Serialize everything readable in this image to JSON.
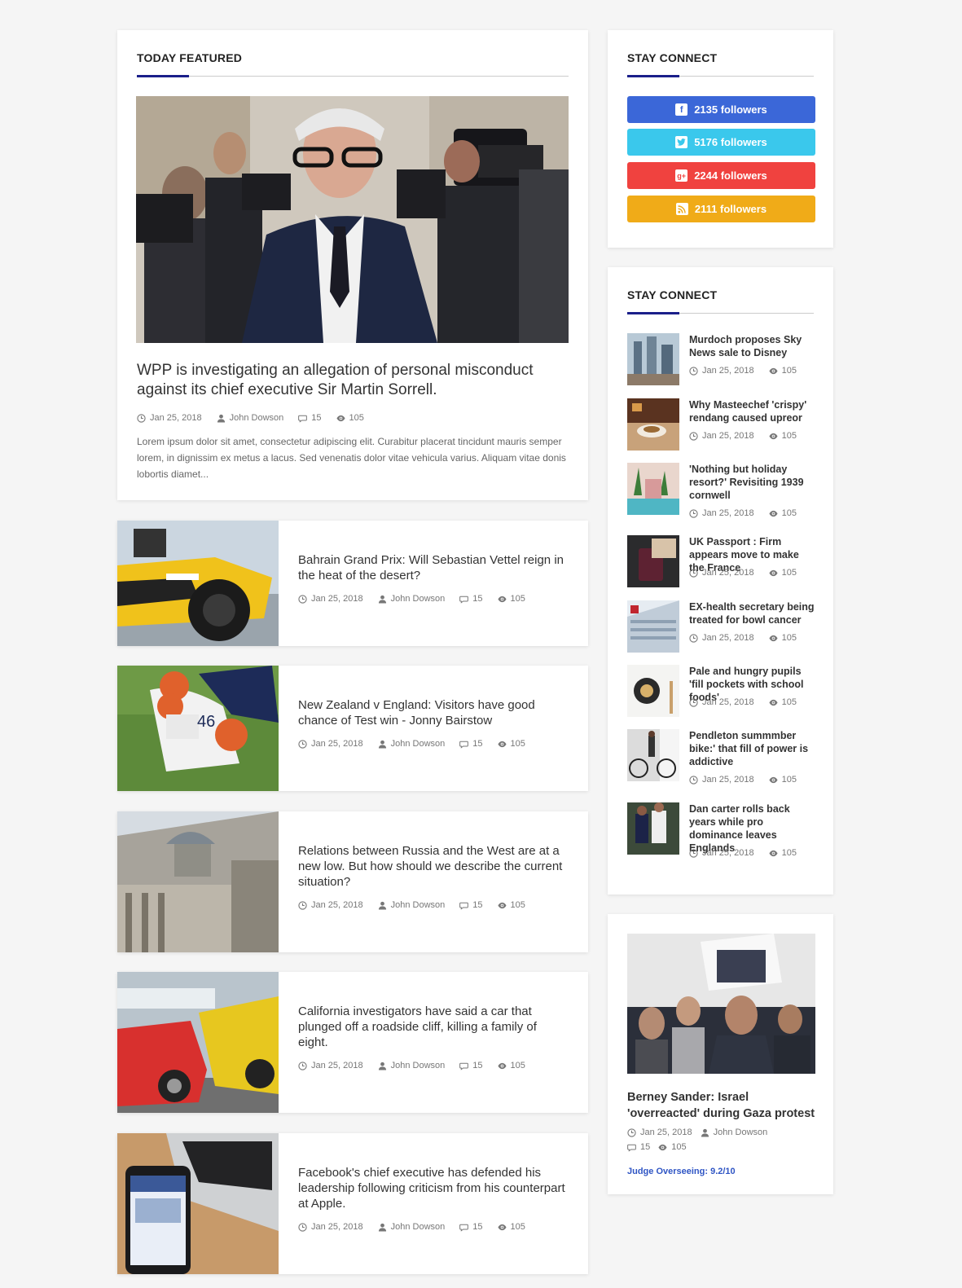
{
  "featured": {
    "heading": "TODAY FEATURED",
    "title": "WPP is investigating an allegation of personal misconduct against its chief executive Sir Martin Sorrell.",
    "date": "Jan 25, 2018",
    "author": "John Dowson",
    "comments": "15",
    "views": "105",
    "excerpt": "Lorem ipsum dolor sit amet, consectetur adipiscing elit. Curabitur placerat tincidunt mauris semper lorem, in dignissim ex metus a lacus. Sed venenatis dolor vitae vehicula varius. Aliquam vitae donis lobortis diamet..."
  },
  "articles": [
    {
      "title": "Bahrain Grand Prix: Will Sebastian Vettel reign in the heat of the desert?",
      "date": "Jan 25, 2018",
      "author": "John Dowson",
      "comments": "15",
      "views": "105"
    },
    {
      "title": "New Zealand v England: Visitors have good chance of Test win - Jonny Bairstow",
      "date": "Jan 25, 2018",
      "author": "John Dowson",
      "comments": "15",
      "views": "105"
    },
    {
      "title": "Relations between Russia and the West are at a new low. But how should we describe the current situation?",
      "date": "Jan 25, 2018",
      "author": "John Dowson",
      "comments": "15",
      "views": "105"
    },
    {
      "title": "California investigators have said a car that plunged off a roadside cliff, killing a family of eight.",
      "date": "Jan 25, 2018",
      "author": "John Dowson",
      "comments": "15",
      "views": "105"
    },
    {
      "title": "Facebook's chief executive has defended his leadership following criticism from his counterpart at Apple.",
      "date": "Jan 25, 2018",
      "author": "John Dowson",
      "comments": "15",
      "views": "105"
    }
  ],
  "social": {
    "heading": "STAY CONNECT",
    "buttons": [
      {
        "label": "2135 followers",
        "icon": "facebook-icon",
        "glyph": "f",
        "color": "#3b67d8"
      },
      {
        "label": "5176 followers",
        "icon": "twitter-icon",
        "glyph": "t",
        "color": "#3ac8ec"
      },
      {
        "label": "2244 followers",
        "icon": "google-plus-icon",
        "glyph": "g+",
        "color": "#f0423f"
      },
      {
        "label": "2111 followers",
        "icon": "rss-icon",
        "glyph": "rss",
        "color": "#f0ab18"
      }
    ]
  },
  "side_list": {
    "heading": "STAY CONNECT",
    "items": [
      {
        "title": "Murdoch proposes Sky News sale to Disney",
        "date": "Jan 25, 2018",
        "views": "105"
      },
      {
        "title": "Why Masteechef 'crispy' rendang caused upreor",
        "date": "Jan 25, 2018",
        "views": "105"
      },
      {
        "title": "'Nothing but holiday resort?' Revisiting 1939 cornwell",
        "date": "Jan 25, 2018",
        "views": "105"
      },
      {
        "title": "UK Passport : Firm appears move to make the France",
        "date": "Jan 25, 2018",
        "views": "105"
      },
      {
        "title": "EX-health secretary being treated for bowl cancer",
        "date": "Jan 25, 2018",
        "views": "105"
      },
      {
        "title": "Pale and hungry pupils 'fill pockets with school foods'",
        "date": "Jan 25, 2018",
        "views": "105"
      },
      {
        "title": "Pendleton summmber bike:' that fill of power is addictive",
        "date": "Jan 25, 2018",
        "views": "105"
      },
      {
        "title": "Dan carter rolls back years while pro dominance leaves Englands",
        "date": "Jan 25, 2018",
        "views": "105"
      }
    ]
  },
  "big_post": {
    "title": "Berney Sander: Israel 'overreacted' during Gaza protest",
    "date": "Jan 25, 2018",
    "author": "John Dowson",
    "comments": "15",
    "views": "105",
    "judge": "Judge Overseeing: 9.2/10"
  }
}
